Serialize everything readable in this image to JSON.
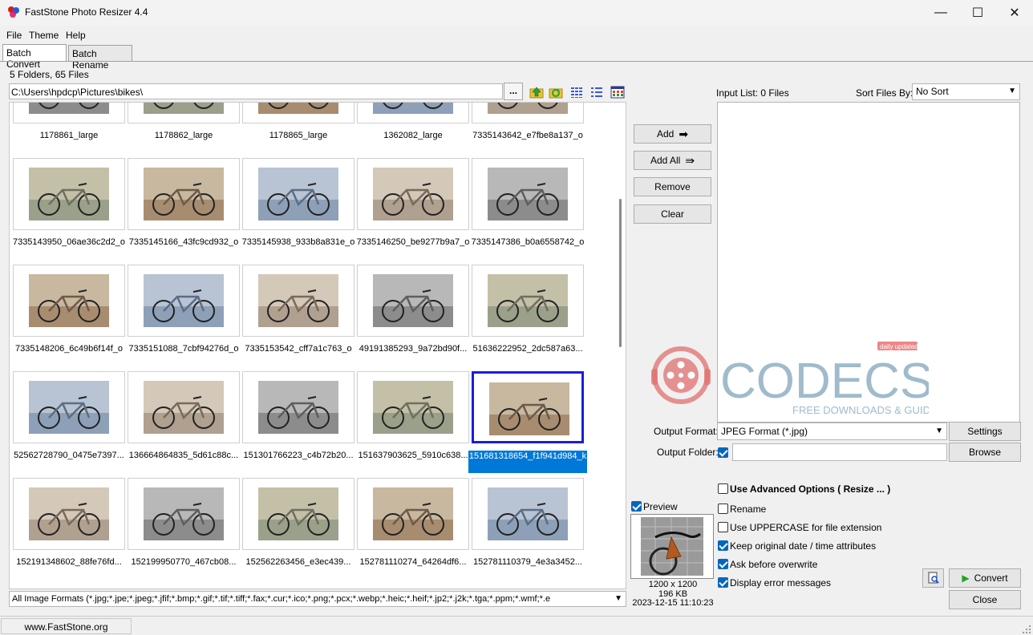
{
  "window": {
    "title": "FastStone Photo Resizer 4.4",
    "minimize": "—",
    "maximize": "☐",
    "close": "✕"
  },
  "menu": [
    "File",
    "Theme",
    "Help"
  ],
  "tabs": [
    "Batch Convert",
    "Batch Rename"
  ],
  "browser": {
    "folder_count": "5 Folders, 65 Files",
    "path": "C:\\Users\\hpdcp\\Pictures\\bikes\\",
    "browse_label": "...",
    "filter": "All Image Formats (*.jpg;*.jpe;*.jpeg;*.jfif;*.bmp;*.gif;*.tif;*.tiff;*.fax;*.cur;*.ico;*.png;*.pcx;*.webp;*.heic;*.heif;*.jp2;*.j2k;*.tga;*.ppm;*.wmf;*.e"
  },
  "thumbnails": [
    [
      "1178861_large",
      "1178862_large",
      "1178865_large",
      "1362082_large",
      "7335143642_e7fbe8a137_o"
    ],
    [
      "7335143950_06ae36c2d2_o",
      "7335145166_43fc9cd932_o",
      "7335145938_933b8a831e_o",
      "7335146250_be9277b9a7_o",
      "7335147386_b0a6558742_o"
    ],
    [
      "7335148206_6c49b6f14f_o",
      "7335151088_7cbf94276d_o",
      "7335153542_cff7a1c763_o",
      "49191385293_9a72bd90f...",
      "51636222952_2dc587a63..."
    ],
    [
      "52562728790_0475e7397...",
      "136664864835_5d61c88c...",
      "151301766223_c4b72b20...",
      "151637903625_5910c638...",
      "151681318654_f1f941d984_k"
    ],
    [
      "152191348602_88fe76fd...",
      "152199950770_467cb08...",
      "152562263456_e3ec439...",
      "152781110274_64264df6...",
      "152781110379_4e3a3452..."
    ]
  ],
  "actions": {
    "add": "Add",
    "add_all": "Add All",
    "remove": "Remove",
    "clear": "Clear"
  },
  "input_list": {
    "label": "Input List:  0 Files",
    "sort_label": "Sort Files By:",
    "sort_value": "No Sort"
  },
  "watermark": {
    "brand": "CODECS",
    "tagline": "FREE DOWNLOADS & GUIDES",
    "badge": "daily updated!"
  },
  "output": {
    "format_label": "Output Format:",
    "format_value": "JPEG Format (*.jpg)",
    "settings_label": "Settings",
    "folder_label": "Output Folder:",
    "browse_label": "Browse"
  },
  "options": {
    "advanced": "Use Advanced Options ( Resize ... )",
    "rename": "Rename",
    "uppercase": "Use UPPERCASE for file extension",
    "keep_date": "Keep original date / time attributes",
    "ask_overwrite": "Ask before overwrite",
    "display_errors": "Display error messages"
  },
  "preview": {
    "label": "Preview",
    "dimensions": "1200 x 1200",
    "size": "196 KB",
    "date": "2023-12-15 11:10:23"
  },
  "buttons": {
    "convert": "Convert",
    "close": "Close"
  },
  "status": {
    "website": "www.FastStone.org"
  }
}
